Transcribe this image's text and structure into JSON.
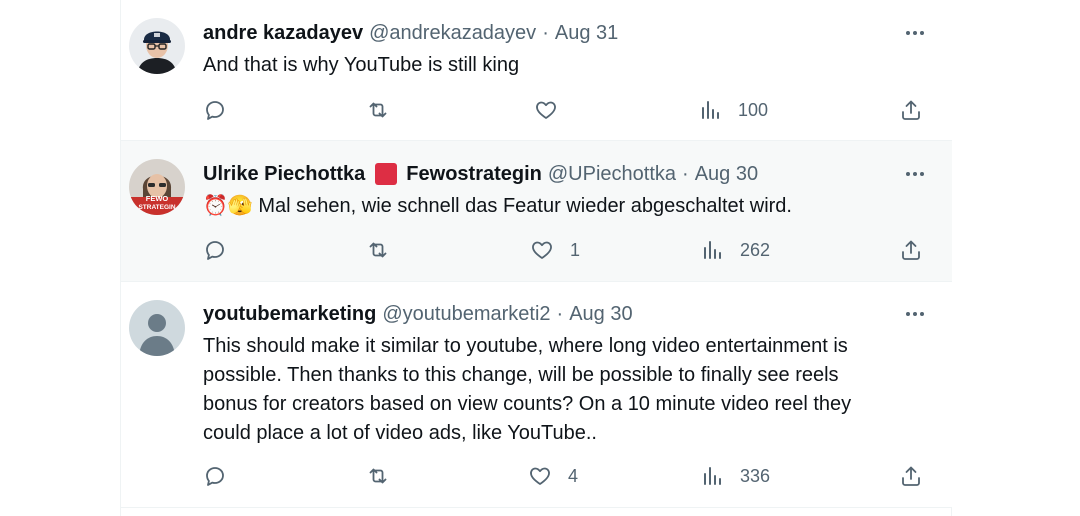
{
  "tweets": [
    {
      "name": "andre kazadayev",
      "handle": "@andrekazadayev",
      "separator": "·",
      "date": "Aug 31",
      "text": "And that is why YouTube is still king",
      "replies": "",
      "retweets": "",
      "likes": "",
      "views": "100",
      "avatar": "man-with-cap-avatar"
    },
    {
      "name": "Ulrike Piechottka",
      "badge_name": "Fewostrategin",
      "handle": "@UPiechottka",
      "separator": "·",
      "date": "Aug 30",
      "emoji": "⏰🫣",
      "text": "Mal sehen, wie schnell das Featur wieder abgeschaltet wird.",
      "replies": "",
      "retweets": "",
      "likes": "1",
      "views": "262",
      "avatar": "fewo-strategin-avatar",
      "avatar_text": [
        "FEWO",
        "STRATEGIN"
      ]
    },
    {
      "name": "youtubemarketing",
      "handle": "@youtubemarketi2",
      "separator": "·",
      "date": "Aug 30",
      "text_lines": [
        "This should make it similar to youtube, where long video entertainment is",
        "possible. Then thanks to this change, will be possible to finally see reels",
        "bonus for creators based on view counts? On a 10 minute video reel they",
        "could place a lot of video ads, like YouTube.."
      ],
      "replies": "",
      "retweets": "",
      "likes": "4",
      "views": "336",
      "avatar": "default-profile-avatar"
    }
  ],
  "colors": {
    "text_primary": "#0f1419",
    "text_secondary": "#536471",
    "divider": "#eff3f4",
    "hover_bg": "#f7f9f9",
    "flag_red": "#dd2e44"
  }
}
